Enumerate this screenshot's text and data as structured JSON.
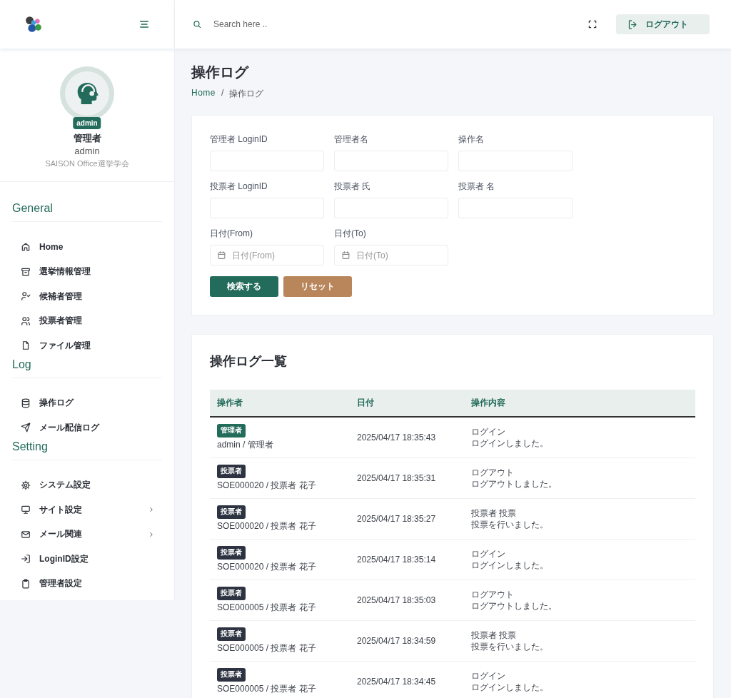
{
  "header": {
    "search": {
      "placeholder": "Search here .."
    },
    "logout": "ログアウト"
  },
  "sidebar": {
    "profile": {
      "badge": "admin",
      "name": "管理者",
      "login": "admin",
      "org": "SAISON Office選挙学会"
    },
    "sections": [
      {
        "title": "General",
        "items": [
          {
            "label": "Home",
            "submenu": false
          },
          {
            "label": "選挙情報管理",
            "submenu": false
          },
          {
            "label": "候補者管理",
            "submenu": false
          },
          {
            "label": "投票者管理",
            "submenu": false
          },
          {
            "label": "ファイル管理",
            "submenu": false
          }
        ]
      },
      {
        "title": "Log",
        "items": [
          {
            "label": "操作ログ",
            "submenu": false
          },
          {
            "label": "メール配信ログ",
            "submenu": false
          }
        ]
      },
      {
        "title": "Setting",
        "items": [
          {
            "label": "システム設定",
            "submenu": false
          },
          {
            "label": "サイト設定",
            "submenu": true
          },
          {
            "label": "メール関連",
            "submenu": true
          },
          {
            "label": "LoginID設定",
            "submenu": false
          },
          {
            "label": "管理者設定",
            "submenu": false
          }
        ]
      }
    ]
  },
  "page": {
    "title": "操作ログ",
    "breadcrumb": [
      "Home",
      "操作ログ"
    ],
    "separator": "/"
  },
  "filters": {
    "fields": [
      {
        "label": "管理者 LoginID",
        "kind": "text"
      },
      {
        "label": "管理者名",
        "kind": "text"
      },
      {
        "label": "操作名",
        "kind": "text"
      },
      {
        "label": "投票者 LoginID",
        "kind": "text"
      },
      {
        "label": "投票者 氏",
        "kind": "text"
      },
      {
        "label": "投票者 名",
        "kind": "text"
      },
      {
        "label": "日付(From)",
        "kind": "date",
        "placeholder": "日付(From)"
      },
      {
        "label": "日付(To)",
        "kind": "date",
        "placeholder": "日付(To)"
      }
    ],
    "buttons": [
      {
        "label": "検索する",
        "kind": "primary"
      },
      {
        "label": "リセット",
        "kind": "secondary"
      }
    ]
  },
  "log_list": {
    "title": "操作ログ一覧",
    "columns": [
      "操作者",
      "日付",
      "操作内容"
    ],
    "rows": [
      {
        "role": {
          "label": "管理者",
          "kind": "admin"
        },
        "operator": "admin / 管理者",
        "date": "2025/04/17 18:35:43",
        "action": "ログイン",
        "detail": "ログインしました。"
      },
      {
        "role": {
          "label": "投票者",
          "kind": "voter"
        },
        "operator": "SOE000020 / 投票者 花子",
        "date": "2025/04/17 18:35:31",
        "action": "ログアウト",
        "detail": "ログアウトしました。"
      },
      {
        "role": {
          "label": "投票者",
          "kind": "voter"
        },
        "operator": "SOE000020 / 投票者 花子",
        "date": "2025/04/17 18:35:27",
        "action": "投票者 投票",
        "detail": "投票を行いました。"
      },
      {
        "role": {
          "label": "投票者",
          "kind": "voter"
        },
        "operator": "SOE000020 / 投票者 花子",
        "date": "2025/04/17 18:35:14",
        "action": "ログイン",
        "detail": "ログインしました。"
      },
      {
        "role": {
          "label": "投票者",
          "kind": "voter"
        },
        "operator": "SOE000005 / 投票者 花子",
        "date": "2025/04/17 18:35:03",
        "action": "ログアウト",
        "detail": "ログアウトしました。"
      },
      {
        "role": {
          "label": "投票者",
          "kind": "voter"
        },
        "operator": "SOE000005 / 投票者 花子",
        "date": "2025/04/17 18:34:59",
        "action": "投票者 投票",
        "detail": "投票を行いました。"
      },
      {
        "role": {
          "label": "投票者",
          "kind": "voter"
        },
        "operator": "SOE000005 / 投票者 花子",
        "date": "2025/04/17 18:34:45",
        "action": "ログイン",
        "detail": "ログインしました。"
      }
    ]
  }
}
